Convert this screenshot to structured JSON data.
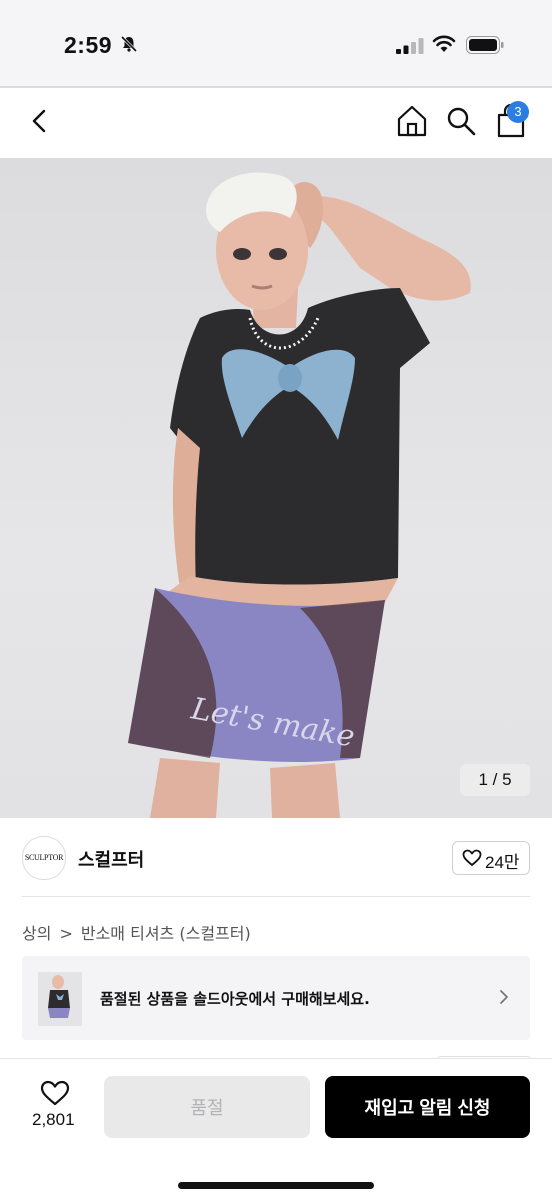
{
  "status_bar": {
    "time": "2:59"
  },
  "nav": {
    "cart_count": "3"
  },
  "hero": {
    "pager": "1 / 5"
  },
  "brand": {
    "logo_text": "SCULPTOR",
    "name": "스컬프터",
    "like_count": "24만"
  },
  "breadcrumb": {
    "category": "상의",
    "subcategory": "반소매 티셔츠 (스컬프터)"
  },
  "banner": {
    "text": "품절된 상품을 솔드아웃에서 구매해보세요."
  },
  "bottom_bar": {
    "wish_count": "2,801",
    "soldout_label": "품절",
    "restock_label": "재입고 알림 신청"
  },
  "colors": {
    "accent": "#2a7de1",
    "primary_button": "#000000"
  }
}
